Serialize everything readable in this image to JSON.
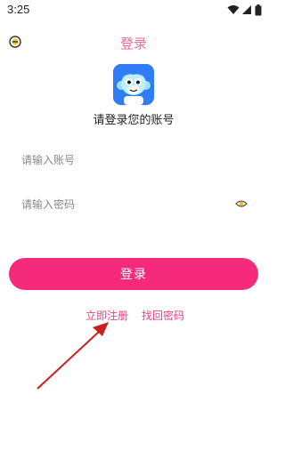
{
  "status": {
    "time": "3:25"
  },
  "header": {
    "title": "登录"
  },
  "app": {
    "subtitle": "请登录您的账号"
  },
  "form": {
    "account_placeholder": "请输入账号",
    "password_placeholder": "请输入密码",
    "login_label": "登录"
  },
  "links": {
    "register": "立即注册",
    "forgot": "找回密码"
  },
  "colors": {
    "accent": "#f52a7b",
    "title": "#f36b98",
    "link": "#f0427f",
    "logo_bg": "#2e7df6",
    "arrow": "#cc1f1f"
  },
  "icons": {
    "back": "back-circle-icon",
    "eye": "eye-icon",
    "logo": "monkey-logo-icon",
    "wifi": "wifi-icon",
    "signal": "signal-icon",
    "battery": "battery-icon"
  }
}
